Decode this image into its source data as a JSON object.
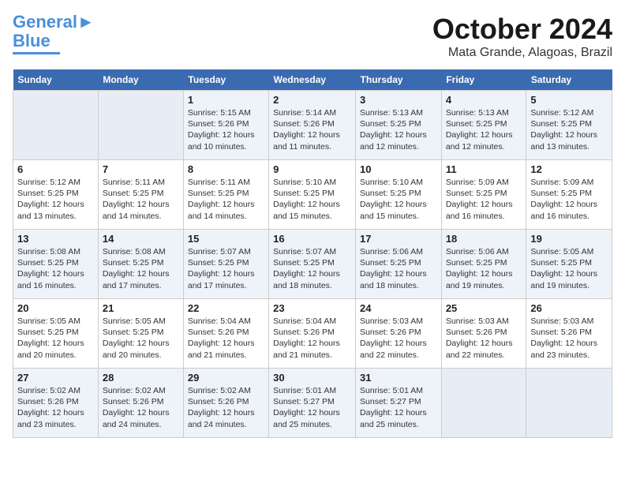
{
  "logo": {
    "line1": "General",
    "line2": "Blue"
  },
  "header": {
    "month": "October 2024",
    "location": "Mata Grande, Alagoas, Brazil"
  },
  "weekdays": [
    "Sunday",
    "Monday",
    "Tuesday",
    "Wednesday",
    "Thursday",
    "Friday",
    "Saturday"
  ],
  "weeks": [
    [
      {
        "day": "",
        "empty": true
      },
      {
        "day": "",
        "empty": true
      },
      {
        "day": "1",
        "sunrise": "5:15 AM",
        "sunset": "5:26 PM",
        "daylight": "12 hours and 10 minutes."
      },
      {
        "day": "2",
        "sunrise": "5:14 AM",
        "sunset": "5:26 PM",
        "daylight": "12 hours and 11 minutes."
      },
      {
        "day": "3",
        "sunrise": "5:13 AM",
        "sunset": "5:25 PM",
        "daylight": "12 hours and 12 minutes."
      },
      {
        "day": "4",
        "sunrise": "5:13 AM",
        "sunset": "5:25 PM",
        "daylight": "12 hours and 12 minutes."
      },
      {
        "day": "5",
        "sunrise": "5:12 AM",
        "sunset": "5:25 PM",
        "daylight": "12 hours and 13 minutes."
      }
    ],
    [
      {
        "day": "6",
        "sunrise": "5:12 AM",
        "sunset": "5:25 PM",
        "daylight": "12 hours and 13 minutes."
      },
      {
        "day": "7",
        "sunrise": "5:11 AM",
        "sunset": "5:25 PM",
        "daylight": "12 hours and 14 minutes."
      },
      {
        "day": "8",
        "sunrise": "5:11 AM",
        "sunset": "5:25 PM",
        "daylight": "12 hours and 14 minutes."
      },
      {
        "day": "9",
        "sunrise": "5:10 AM",
        "sunset": "5:25 PM",
        "daylight": "12 hours and 15 minutes."
      },
      {
        "day": "10",
        "sunrise": "5:10 AM",
        "sunset": "5:25 PM",
        "daylight": "12 hours and 15 minutes."
      },
      {
        "day": "11",
        "sunrise": "5:09 AM",
        "sunset": "5:25 PM",
        "daylight": "12 hours and 16 minutes."
      },
      {
        "day": "12",
        "sunrise": "5:09 AM",
        "sunset": "5:25 PM",
        "daylight": "12 hours and 16 minutes."
      }
    ],
    [
      {
        "day": "13",
        "sunrise": "5:08 AM",
        "sunset": "5:25 PM",
        "daylight": "12 hours and 16 minutes."
      },
      {
        "day": "14",
        "sunrise": "5:08 AM",
        "sunset": "5:25 PM",
        "daylight": "12 hours and 17 minutes."
      },
      {
        "day": "15",
        "sunrise": "5:07 AM",
        "sunset": "5:25 PM",
        "daylight": "12 hours and 17 minutes."
      },
      {
        "day": "16",
        "sunrise": "5:07 AM",
        "sunset": "5:25 PM",
        "daylight": "12 hours and 18 minutes."
      },
      {
        "day": "17",
        "sunrise": "5:06 AM",
        "sunset": "5:25 PM",
        "daylight": "12 hours and 18 minutes."
      },
      {
        "day": "18",
        "sunrise": "5:06 AM",
        "sunset": "5:25 PM",
        "daylight": "12 hours and 19 minutes."
      },
      {
        "day": "19",
        "sunrise": "5:05 AM",
        "sunset": "5:25 PM",
        "daylight": "12 hours and 19 minutes."
      }
    ],
    [
      {
        "day": "20",
        "sunrise": "5:05 AM",
        "sunset": "5:25 PM",
        "daylight": "12 hours and 20 minutes."
      },
      {
        "day": "21",
        "sunrise": "5:05 AM",
        "sunset": "5:25 PM",
        "daylight": "12 hours and 20 minutes."
      },
      {
        "day": "22",
        "sunrise": "5:04 AM",
        "sunset": "5:26 PM",
        "daylight": "12 hours and 21 minutes."
      },
      {
        "day": "23",
        "sunrise": "5:04 AM",
        "sunset": "5:26 PM",
        "daylight": "12 hours and 21 minutes."
      },
      {
        "day": "24",
        "sunrise": "5:03 AM",
        "sunset": "5:26 PM",
        "daylight": "12 hours and 22 minutes."
      },
      {
        "day": "25",
        "sunrise": "5:03 AM",
        "sunset": "5:26 PM",
        "daylight": "12 hours and 22 minutes."
      },
      {
        "day": "26",
        "sunrise": "5:03 AM",
        "sunset": "5:26 PM",
        "daylight": "12 hours and 23 minutes."
      }
    ],
    [
      {
        "day": "27",
        "sunrise": "5:02 AM",
        "sunset": "5:26 PM",
        "daylight": "12 hours and 23 minutes."
      },
      {
        "day": "28",
        "sunrise": "5:02 AM",
        "sunset": "5:26 PM",
        "daylight": "12 hours and 24 minutes."
      },
      {
        "day": "29",
        "sunrise": "5:02 AM",
        "sunset": "5:26 PM",
        "daylight": "12 hours and 24 minutes."
      },
      {
        "day": "30",
        "sunrise": "5:01 AM",
        "sunset": "5:27 PM",
        "daylight": "12 hours and 25 minutes."
      },
      {
        "day": "31",
        "sunrise": "5:01 AM",
        "sunset": "5:27 PM",
        "daylight": "12 hours and 25 minutes."
      },
      {
        "day": "",
        "empty": true
      },
      {
        "day": "",
        "empty": true
      }
    ]
  ]
}
